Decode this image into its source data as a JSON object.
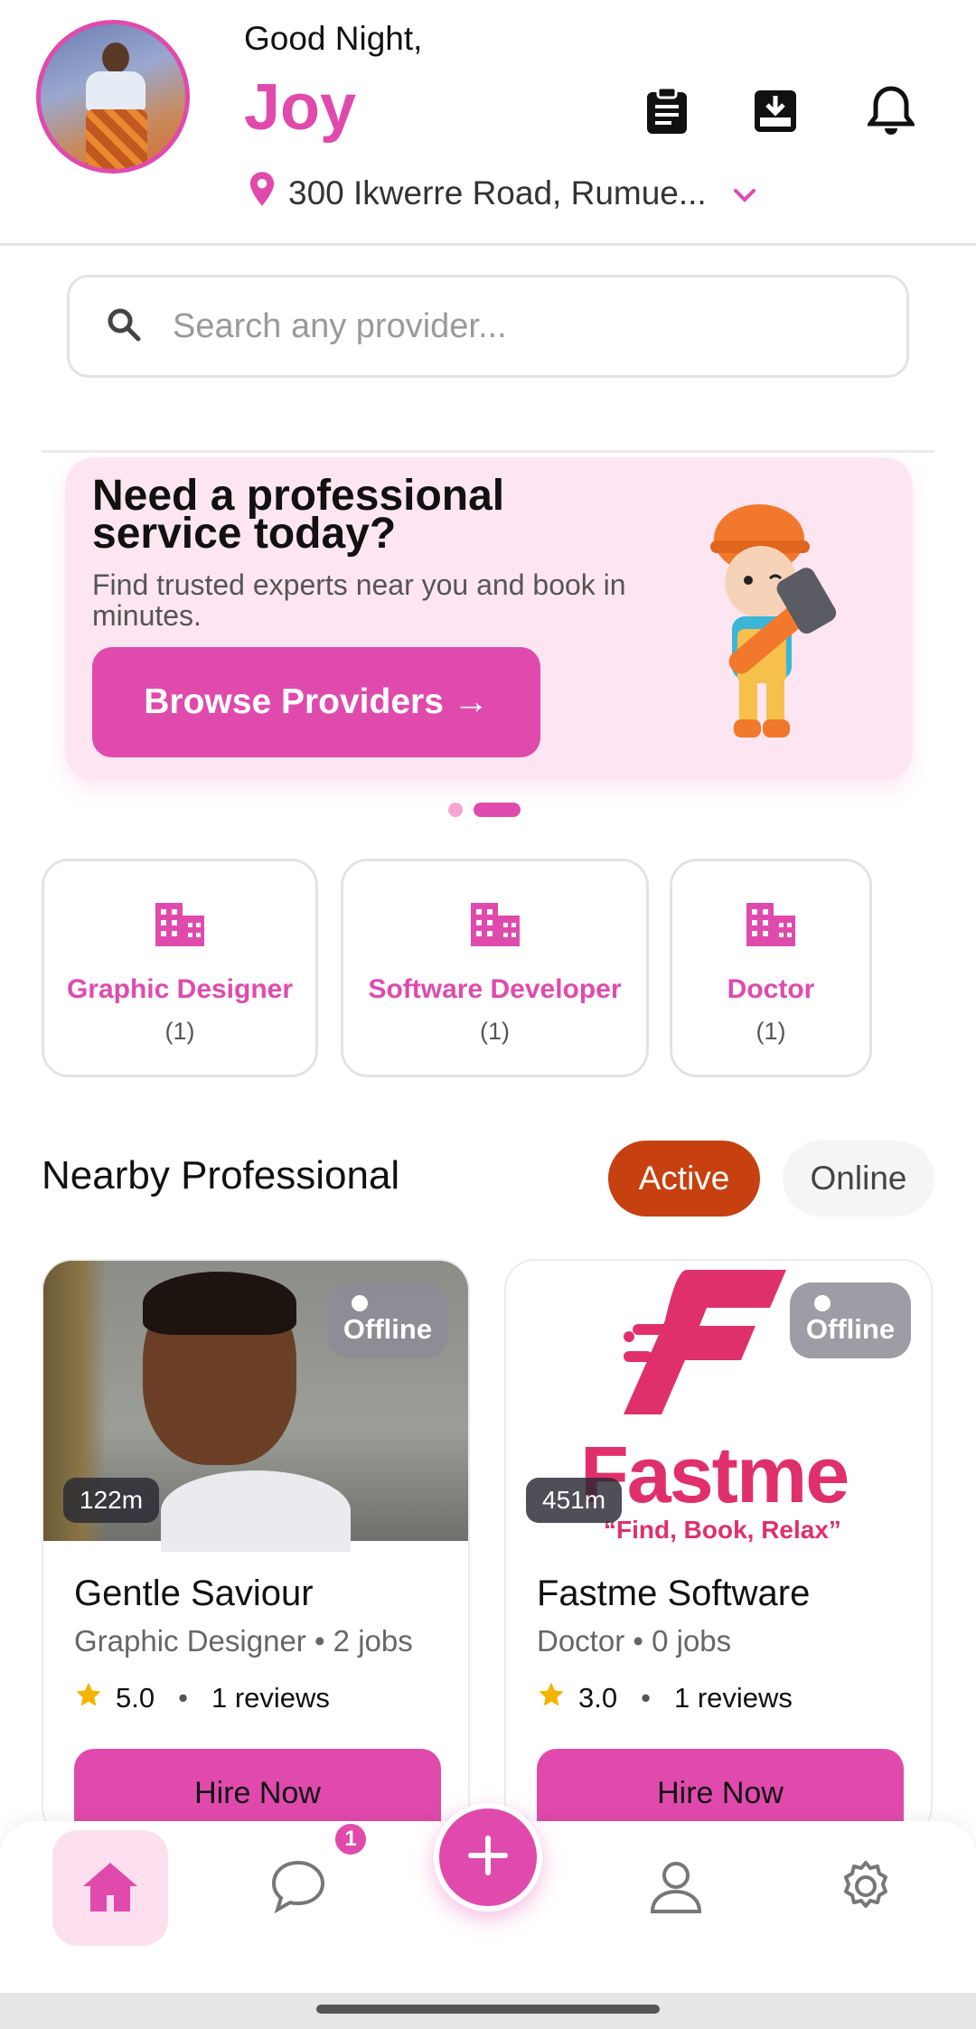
{
  "header": {
    "greeting": "Good Night,",
    "user_name": "Joy",
    "location": "300 Ikwerre Road, Rumue..."
  },
  "search": {
    "placeholder": "Search any provider..."
  },
  "banner": {
    "title": "Need a professional service today?",
    "subtitle": "Find trusted experts near you and book in minutes.",
    "button_label": "Browse Providers →",
    "slide_count": 2,
    "active_slide": 2
  },
  "categories": [
    {
      "name": "Graphic Designer",
      "count": "(1)"
    },
    {
      "name": "Software Developer",
      "count": "(1)"
    },
    {
      "name": "Doctor",
      "count": "(1)"
    }
  ],
  "nearby": {
    "title": "Nearby Professional",
    "filter_active": "Active",
    "filter_online": "Online",
    "providers": [
      {
        "distance": "122m",
        "status": "Offline",
        "name": "Gentle Saviour",
        "meta": "Graphic Designer • 2 jobs",
        "rating": "5.0",
        "reviews": "1 reviews",
        "button": "Hire Now"
      },
      {
        "distance": "451m",
        "status": "Offline",
        "name": "Fastme Software",
        "meta": "Doctor • 0 jobs",
        "rating": "3.0",
        "reviews": "1 reviews",
        "button": "Hire Now",
        "logo_text": "Fastme",
        "logo_tagline": "“Find, Book, Relax”"
      }
    ]
  },
  "bottom_nav": {
    "items": [
      "home",
      "chat",
      "add",
      "profile",
      "settings"
    ],
    "chat_badge": "1"
  },
  "colors": {
    "accent": "#e04aad",
    "active_pill": "#c7400f",
    "banner_bg": "#fde6f2"
  }
}
